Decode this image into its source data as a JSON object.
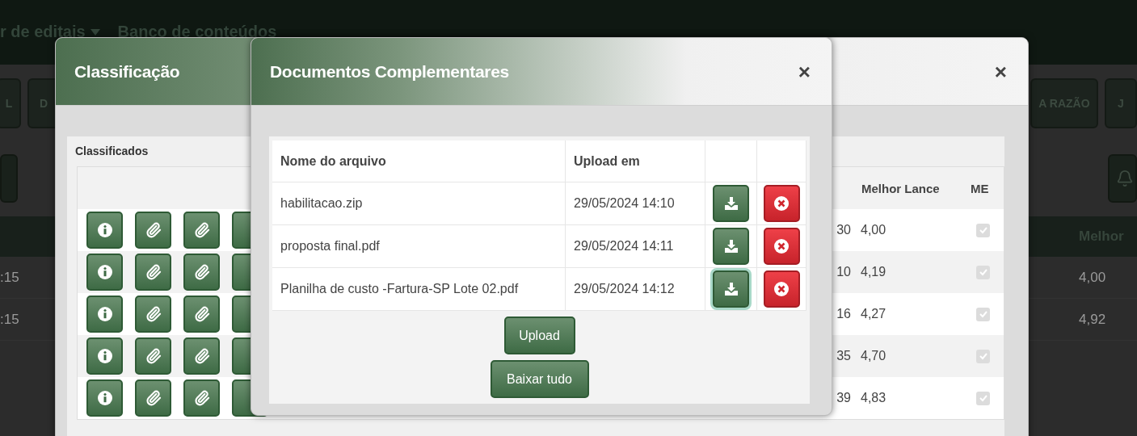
{
  "background": {
    "nav_items": [
      {
        "label": "r de editais",
        "dropdown": true
      },
      {
        "label": "Banco de conteúdos",
        "dropdown": false
      }
    ],
    "toolbar_left": [
      "L",
      "D"
    ],
    "toolbar_right": [
      "A RAZÃO",
      "J"
    ],
    "table_header": "Melhor",
    "rows": [
      {
        "column_1": ":15",
        "column_2": "4,00"
      },
      {
        "column_1": ":15",
        "column_2": "4,92"
      }
    ]
  },
  "classification_dialog": {
    "title": "Classificação",
    "close": "×",
    "section_title": "Classificados",
    "columns": [
      "Melhor Lance",
      "ME"
    ],
    "rows": [
      {
        "column_3": "30",
        "best_bid": "4,00",
        "me_checked": true
      },
      {
        "column_3": "10",
        "best_bid": "4,19",
        "me_checked": true
      },
      {
        "column_3": "16",
        "best_bid": "4,27",
        "me_checked": true
      },
      {
        "column_3": "35",
        "best_bid": "4,70",
        "me_checked": true
      },
      {
        "column_3": "39",
        "best_bid": "4,83",
        "me_checked": true
      }
    ]
  },
  "documents_dialog": {
    "title": "Documentos Complementares",
    "close": "×",
    "columns": [
      "Nome do arquivo",
      "Upload em"
    ],
    "files": [
      {
        "name": "habilitacao.zip",
        "uploaded_at": "29/05/2024 14:10",
        "focused": false
      },
      {
        "name": "proposta final.pdf",
        "uploaded_at": "29/05/2024 14:11",
        "focused": false
      },
      {
        "name": "Planilha de custo -Fartura-SP Lote 02.pdf",
        "uploaded_at": "29/05/2024 14:12",
        "focused": true
      }
    ],
    "buttons": [
      "Upload",
      "Baixar tudo"
    ]
  }
}
